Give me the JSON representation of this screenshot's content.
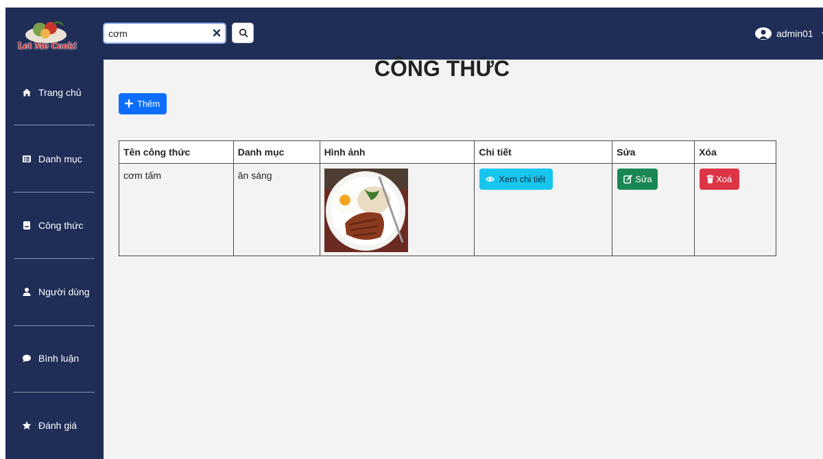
{
  "app": {
    "logo_text": "Let Me Cook!"
  },
  "search": {
    "value": "cơm",
    "placeholder": ""
  },
  "user": {
    "name": "admin01"
  },
  "sidebar": {
    "items": [
      {
        "label": "Trang chủ",
        "icon": "home-icon"
      },
      {
        "label": "Danh mục",
        "icon": "list-icon"
      },
      {
        "label": "Công thức",
        "icon": "book-icon"
      },
      {
        "label": "Người dùng",
        "icon": "user-icon"
      },
      {
        "label": "Bình luận",
        "icon": "comment-icon"
      },
      {
        "label": "Đánh giá",
        "icon": "star-icon"
      }
    ]
  },
  "main": {
    "title": "CÔNG THỨC",
    "add_label": "Thêm",
    "table": {
      "headers": [
        "Tên công thức",
        "Danh mục",
        "Hình ảnh",
        "Chi tiết",
        "Sửa",
        "Xóa"
      ],
      "rows": [
        {
          "name": "cơm tấm",
          "category": "ăn sáng",
          "view_label": "Xem chi tiết",
          "edit_label": "Sửa",
          "delete_label": "Xoá"
        }
      ]
    }
  },
  "colors": {
    "navy": "#1f2d57",
    "primary": "#0d6efd",
    "info": "#17c6ef",
    "success": "#198754",
    "danger": "#dc3545",
    "background": "#f3f3f3"
  }
}
